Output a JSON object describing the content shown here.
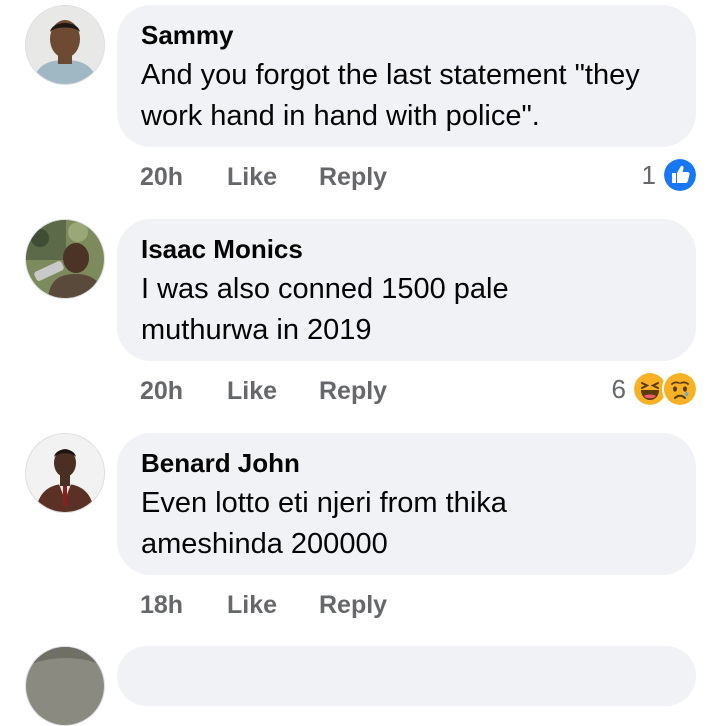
{
  "comments": [
    {
      "author": "Sammy",
      "text": "And you forgot the last statement \"they work hand in hand with police\".",
      "time": "20h",
      "like_label": "Like",
      "reply_label": "Reply",
      "reaction_count": "1",
      "reactions": [
        "like-icon"
      ]
    },
    {
      "author": "Isaac Monics",
      "text": "I was also conned 1500 pale muthurwa in 2019",
      "time": "20h",
      "like_label": "Like",
      "reply_label": "Reply",
      "reaction_count": "6",
      "reactions": [
        "haha-icon",
        "sad-icon"
      ]
    },
    {
      "author": "Benard John",
      "text": "Even lotto eti njeri from thika ameshinda 200000",
      "time": "18h",
      "like_label": "Like",
      "reply_label": "Reply"
    }
  ],
  "colors": {
    "bubble": "#f0f2f5",
    "meta_text": "#65676b",
    "like_blue": "#1877f2",
    "haha_yellow": "#f7b125"
  }
}
